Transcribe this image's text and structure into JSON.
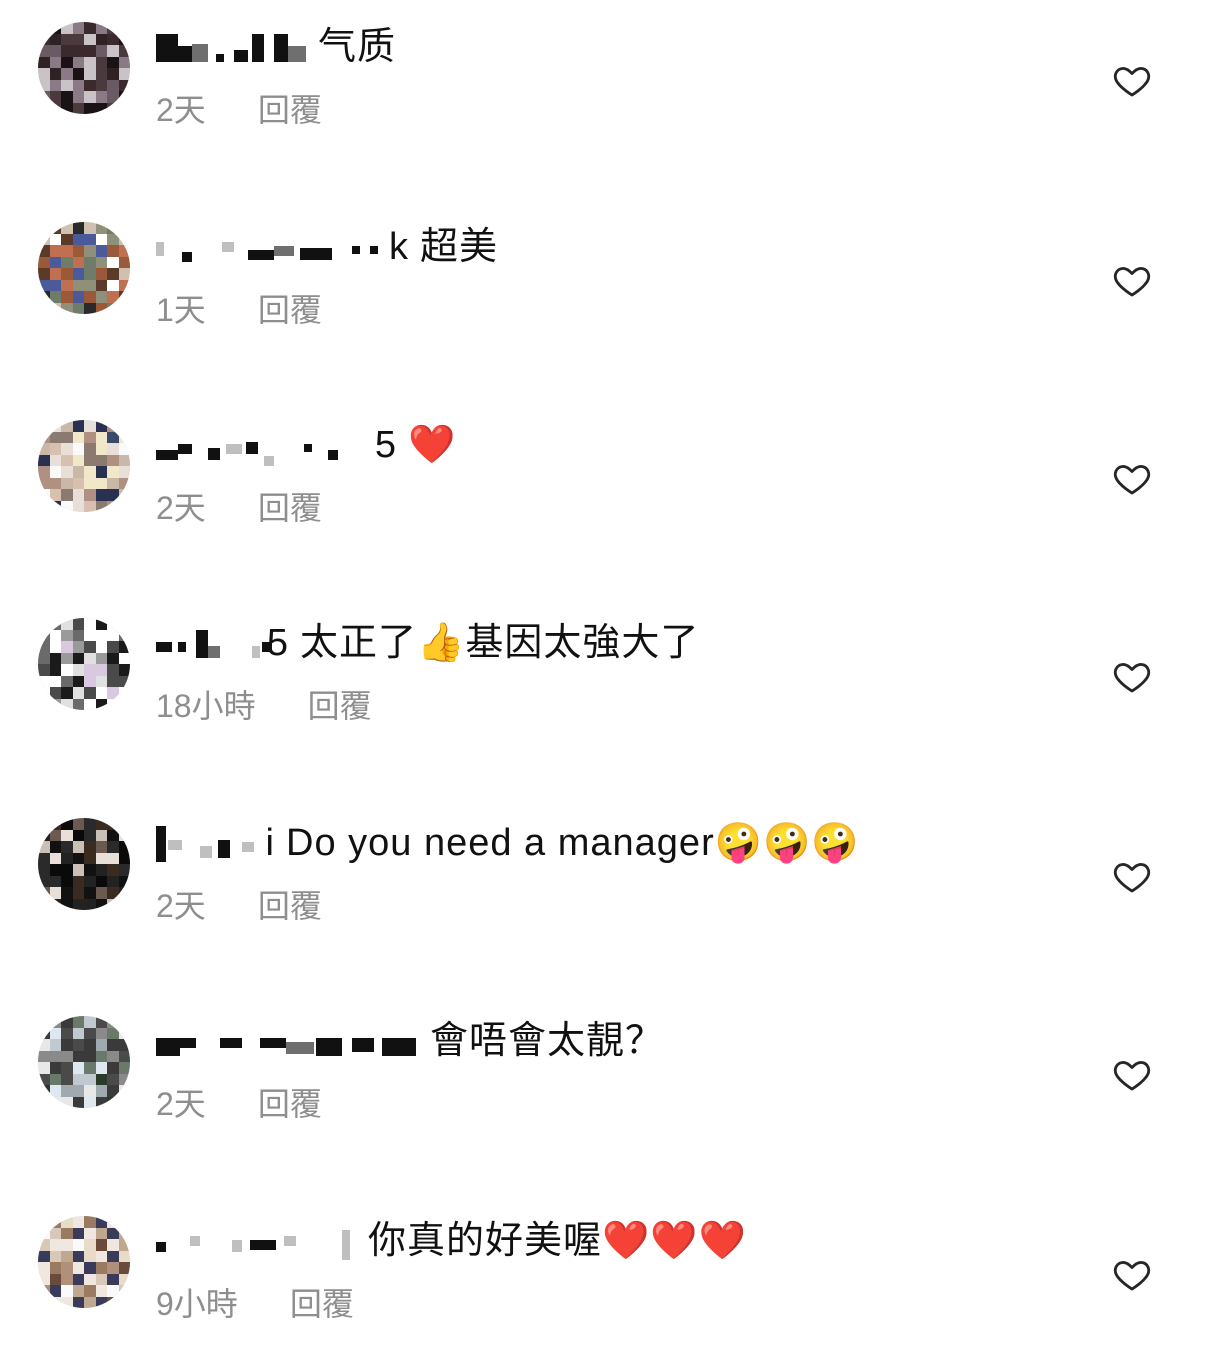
{
  "reply_label": "回覆",
  "comments": [
    {
      "username_tail": "",
      "text": "气质",
      "time": "2天"
    },
    {
      "username_tail": "k",
      "text": "超美",
      "time": "1天"
    },
    {
      "username_tail": "5",
      "text": "❤️",
      "time": "2天"
    },
    {
      "username_tail": "5",
      "text": "太正了👍基因太強大了",
      "time": "18小時"
    },
    {
      "username_tail": "i",
      "text": "Do you need a manager🤪🤪🤪",
      "time": "2天"
    },
    {
      "username_tail": "",
      "text": "會唔會太靚？",
      "time": "2天"
    },
    {
      "username_tail": "",
      "text": "你真的好美喔❤️❤️❤️",
      "time": "9小時"
    }
  ],
  "icons": {
    "like": "heart-outline-icon",
    "avatar": "blurred-avatar"
  },
  "colors": {
    "text": "#111111",
    "meta": "#8e8e8e",
    "heart_outline": "#262626",
    "background": "#ffffff"
  }
}
